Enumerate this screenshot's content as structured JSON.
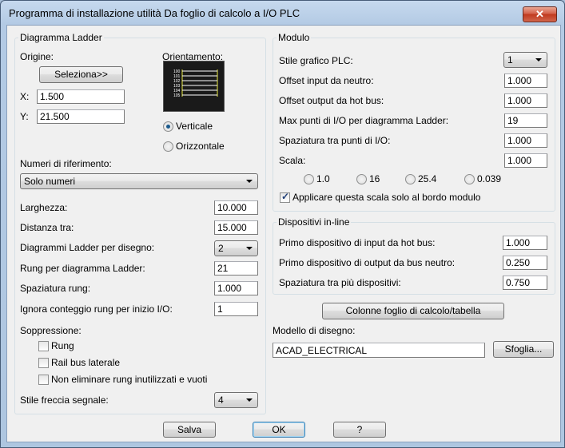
{
  "window": {
    "title": "Programma di installazione utilità Da foglio di calcolo a I/O PLC",
    "close_glyph": "✕"
  },
  "ladder": {
    "group_title": "Diagramma Ladder",
    "origin_label": "Origine:",
    "select_button": "Seleziona>>",
    "x_label": "X:",
    "x_value": "1.500",
    "y_label": "Y:",
    "y_value": "21.500",
    "orientation_label": "Orientamento:",
    "orientation_options": [
      "Verticale",
      "Orizzontale"
    ],
    "orientation_selected": "Verticale",
    "preview_numbers": [
      "100",
      "101",
      "102",
      "103",
      "104",
      "105"
    ],
    "ref_numbers_label": "Numeri di riferimento:",
    "ref_numbers_value": "Solo numeri",
    "width_label": "Larghezza:",
    "width_value": "10.000",
    "distance_label": "Distanza tra:",
    "distance_value": "15.000",
    "per_drawing_label": "Diagrammi Ladder per disegno:",
    "per_drawing_value": "2",
    "rungs_label": "Rung per diagramma Ladder:",
    "rungs_value": "21",
    "rung_spacing_label": "Spaziatura rung:",
    "rung_spacing_value": "1.000",
    "skip_label": "Ignora conteggio rung per inizio I/O:",
    "skip_value": "1",
    "suppression_label": "Soppressione:",
    "suppression_items": [
      {
        "label": "Rung",
        "checked": false
      },
      {
        "label": "Rail bus laterale",
        "checked": false
      },
      {
        "label": "Non eliminare rung inutilizzati e vuoti",
        "checked": false
      }
    ],
    "arrow_style_label": "Stile freccia segnale:",
    "arrow_style_value": "4"
  },
  "module": {
    "group_title": "Modulo",
    "plc_style_label": "Stile grafico PLC:",
    "plc_style_value": "1",
    "offset_input_label": "Offset input da neutro:",
    "offset_input_value": "1.000",
    "offset_output_label": "Offset output da hot bus:",
    "offset_output_value": "1.000",
    "max_points_label": "Max punti di I/O per diagramma Ladder:",
    "max_points_value": "19",
    "io_spacing_label": "Spaziatura tra punti di I/O:",
    "io_spacing_value": "1.000",
    "scale_label": "Scala:",
    "scale_value": "1.000",
    "scale_options": [
      "1.0",
      "16",
      "25.4",
      "0.039"
    ],
    "apply_scale_label": "Applicare questa scala solo al bordo modulo",
    "apply_scale_checked": true
  },
  "inline": {
    "group_title": "Dispositivi in-line",
    "first_input_label": "Primo dispositivo di input da hot bus:",
    "first_input_value": "1.000",
    "first_output_label": "Primo dispositivo di output da bus neutro:",
    "first_output_value": "0.250",
    "spacing_label": "Spaziatura tra più dispositivi:",
    "spacing_value": "0.750"
  },
  "columns_button": "Colonne foglio di calcolo/tabella",
  "template": {
    "label": "Modello di disegno:",
    "value": "ACAD_ELECTRICAL",
    "browse_button": "Sfoglia..."
  },
  "footer": {
    "save": "Salva",
    "ok": "OK",
    "help": "?"
  }
}
